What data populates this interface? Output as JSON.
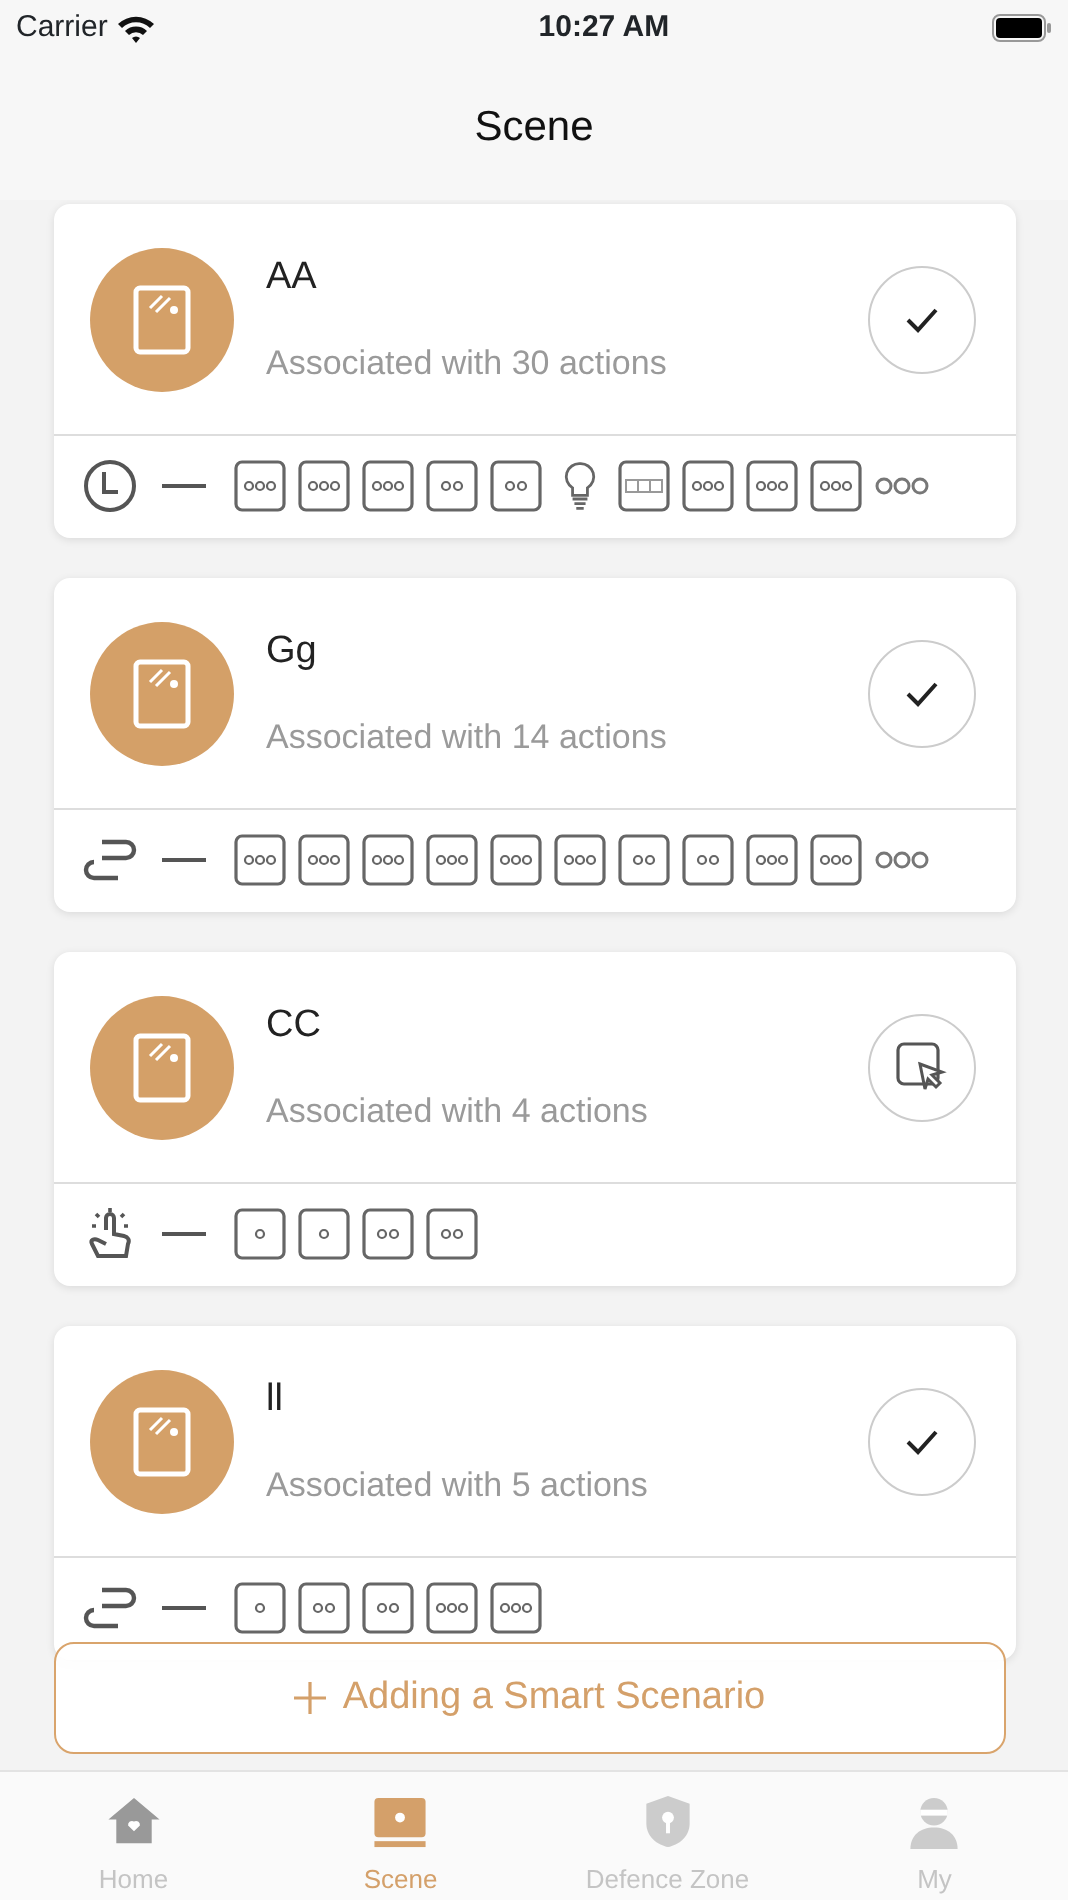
{
  "status_bar": {
    "carrier": "Carrier",
    "time": "10:27 AM"
  },
  "header": {
    "title": "Scene"
  },
  "scenes": [
    {
      "name": "AA",
      "subtitle": "Associated with 30 actions",
      "action": {
        "kind": "check"
      },
      "trigger": {
        "kind": "timer"
      },
      "devices": [
        {
          "kind": "switch3"
        },
        {
          "kind": "switch3"
        },
        {
          "kind": "switch3"
        },
        {
          "kind": "switch2"
        },
        {
          "kind": "switch2"
        },
        {
          "kind": "bulb"
        },
        {
          "kind": "curtain"
        },
        {
          "kind": "switch3"
        },
        {
          "kind": "switch3"
        },
        {
          "kind": "switch3"
        }
      ],
      "more": true
    },
    {
      "name": "Gg",
      "subtitle": "Associated with 14 actions",
      "action": {
        "kind": "check"
      },
      "trigger": {
        "kind": "auto"
      },
      "devices": [
        {
          "kind": "switch3"
        },
        {
          "kind": "switch3"
        },
        {
          "kind": "switch3"
        },
        {
          "kind": "switch3"
        },
        {
          "kind": "switch3"
        },
        {
          "kind": "switch3"
        },
        {
          "kind": "switch2"
        },
        {
          "kind": "switch2"
        },
        {
          "kind": "switch3"
        },
        {
          "kind": "switch3"
        }
      ],
      "more": true
    },
    {
      "name": "CC",
      "subtitle": "Associated with 4 actions",
      "action": {
        "kind": "tap"
      },
      "trigger": {
        "kind": "manual"
      },
      "devices": [
        {
          "kind": "switch1"
        },
        {
          "kind": "switch1"
        },
        {
          "kind": "switch2"
        },
        {
          "kind": "switch2"
        }
      ],
      "more": false
    },
    {
      "name": "ll",
      "subtitle": "Associated with 5 actions",
      "action": {
        "kind": "check"
      },
      "trigger": {
        "kind": "auto"
      },
      "devices": [
        {
          "kind": "switch1"
        },
        {
          "kind": "switch2"
        },
        {
          "kind": "switch2"
        },
        {
          "kind": "switch3"
        },
        {
          "kind": "switch3"
        }
      ],
      "more": false
    }
  ],
  "add_button": {
    "label": "Adding a Smart Scenario"
  },
  "tabs": [
    {
      "label": "Home",
      "selected": false
    },
    {
      "label": "Scene",
      "selected": true
    },
    {
      "label": "Defence Zone",
      "selected": false
    },
    {
      "label": "My",
      "selected": false
    }
  ]
}
